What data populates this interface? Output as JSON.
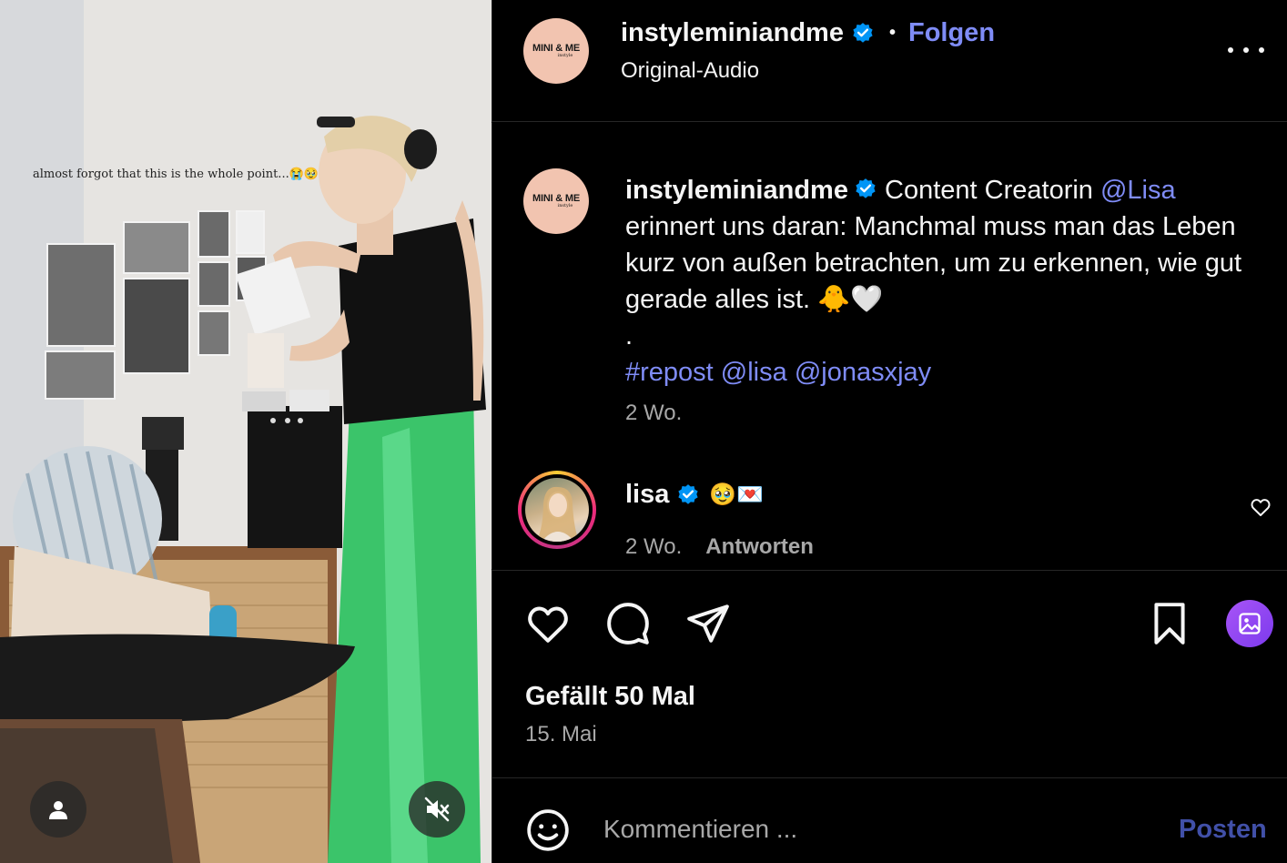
{
  "video": {
    "overlay_text": "almost forgot that this is the whole point...😭🥹",
    "icons": [
      "user-icon",
      "speaker-muted-icon"
    ]
  },
  "header": {
    "avatar_text": "MINI & ME",
    "avatar_subtext": "instyle",
    "username": "instyleminiandme",
    "separator": "•",
    "follow_label": "Folgen",
    "audio_label": "Original-Audio"
  },
  "caption": {
    "avatar_text": "MINI & ME",
    "avatar_subtext": "instyle",
    "username": "instyleminiandme",
    "text_1": " Content Creatorin ",
    "mention_1": "@Lisa",
    "text_2": " erinnert uns daran: Manchmal muss man das Leben kurz von außen betrachten, um zu erkennen, wie gut gerade alles ist. 🐥🤍",
    "dot": ".",
    "hashtag": "#repost",
    "mention_2": "@lisa",
    "mention_3": "@jonasxjay",
    "time": "2 Wo."
  },
  "comment": {
    "username": "lisa",
    "text": "🥹💌",
    "time": "2 Wo.",
    "reply_label": "Antworten"
  },
  "actions": {
    "likes_label": "Gefällt 50 Mal",
    "date": "15. Mai"
  },
  "composer": {
    "placeholder": "Kommentieren ...",
    "post_label": "Posten"
  },
  "colors": {
    "link": "#7f8cf6",
    "verified": "#0095f6",
    "muted_text": "#a8a8a8",
    "post_disabled": "#4150a8"
  }
}
